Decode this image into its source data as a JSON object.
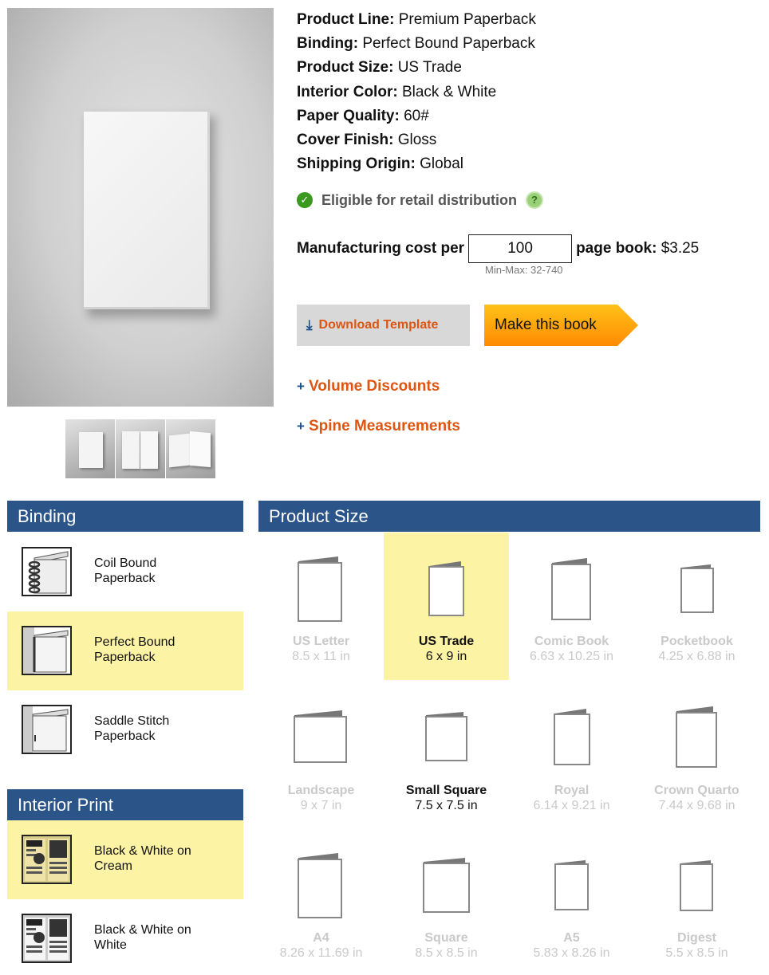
{
  "specs": [
    {
      "key": "Product Line:",
      "value": "Premium Paperback"
    },
    {
      "key": "Binding:",
      "value": "Perfect Bound Paperback"
    },
    {
      "key": "Product Size:",
      "value": "US Trade"
    },
    {
      "key": "Interior Color:",
      "value": "Black & White"
    },
    {
      "key": "Paper Quality:",
      "value": "60#"
    },
    {
      "key": "Cover Finish:",
      "value": "Gloss"
    },
    {
      "key": "Shipping Origin:",
      "value": "Global"
    }
  ],
  "eligible_text": "Eligible for retail distribution",
  "help_glyph": "?",
  "cost": {
    "label_before": "Manufacturing cost per",
    "page_count": "100",
    "label_after": "page book:",
    "price": "$3.25",
    "minmax": "Min-Max: 32-740"
  },
  "buttons": {
    "download": "Download Template",
    "make": "Make this book"
  },
  "expanders": {
    "volume": "Volume Discounts",
    "spine": "Spine Measurements",
    "plus": "+"
  },
  "binding": {
    "title": "Binding",
    "options": [
      {
        "label": "Coil Bound\nPaperback",
        "selected": false
      },
      {
        "label": "Perfect Bound\nPaperback",
        "selected": true
      },
      {
        "label": "Saddle Stitch\nPaperback",
        "selected": false
      }
    ]
  },
  "interior": {
    "title": "Interior Print",
    "options": [
      {
        "label": "Black & White on\nCream",
        "selected": true
      },
      {
        "label": "Black & White on\nWhite",
        "selected": false
      }
    ]
  },
  "product_size": {
    "title": "Product Size",
    "sizes": [
      {
        "name": "US Letter",
        "dims": "8.5 x 11 in",
        "enabled": false,
        "selected": false
      },
      {
        "name": "US Trade",
        "dims": "6 x 9 in",
        "enabled": true,
        "selected": true
      },
      {
        "name": "Comic Book",
        "dims": "6.63 x 10.25 in",
        "enabled": false,
        "selected": false
      },
      {
        "name": "Pocketbook",
        "dims": "4.25 x 6.88 in",
        "enabled": false,
        "selected": false
      },
      {
        "name": "Landscape",
        "dims": "9 x 7 in",
        "enabled": false,
        "selected": false
      },
      {
        "name": "Small Square",
        "dims": "7.5 x 7.5 in",
        "enabled": true,
        "selected": false
      },
      {
        "name": "Royal",
        "dims": "6.14 x 9.21 in",
        "enabled": false,
        "selected": false
      },
      {
        "name": "Crown Quarto",
        "dims": "7.44 x 9.68 in",
        "enabled": false,
        "selected": false
      },
      {
        "name": "A4",
        "dims": "8.26 x 11.69 in",
        "enabled": false,
        "selected": false
      },
      {
        "name": "Square",
        "dims": "8.5 x 8.5 in",
        "enabled": false,
        "selected": false
      },
      {
        "name": "A5",
        "dims": "5.83 x 8.26 in",
        "enabled": false,
        "selected": false
      },
      {
        "name": "Digest",
        "dims": "5.5 x 8.5 in",
        "enabled": false,
        "selected": false
      }
    ]
  },
  "colors": {
    "accent_orange": "#dd5511",
    "header_blue": "#2b5488",
    "selected_yellow": "#fcf3a5"
  }
}
